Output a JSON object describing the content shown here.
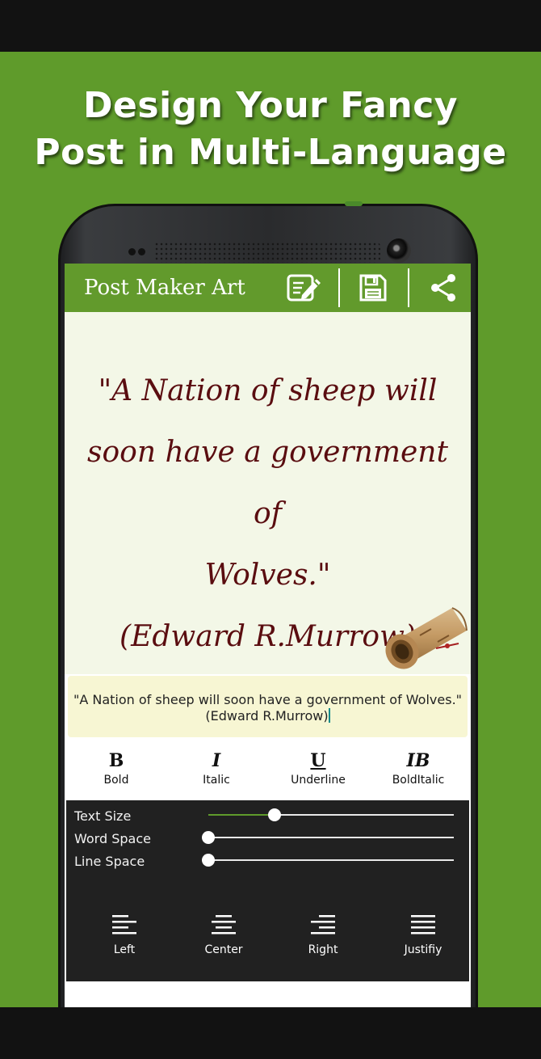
{
  "promo": {
    "headline_line1": "Design Your Fancy",
    "headline_line2": "Post in Multi-Language"
  },
  "appbar": {
    "title": "Post Maker Art",
    "actions": [
      {
        "name": "edit",
        "icon": "edit-note-icon"
      },
      {
        "name": "save",
        "icon": "save-floppy-icon"
      },
      {
        "name": "share",
        "icon": "share-icon"
      }
    ]
  },
  "canvas": {
    "quote_text": "\"A Nation of sheep will\nsoon have a government of\nWolves.\"\n(Edward R.Murrow)",
    "quote_color": "#5a0d10",
    "background_color": "#f3f7e7",
    "decoration": "parchment-scroll-image"
  },
  "editor": {
    "value": "\"A Nation of sheep will soon have a government of Wolves.\"\n(Edward R.Murrow)"
  },
  "styles": [
    {
      "glyph": "B",
      "label": "Bold"
    },
    {
      "glyph": "I",
      "label": "Italic"
    },
    {
      "glyph": "U",
      "label": "Underline"
    },
    {
      "glyph": "IB",
      "label": "BoldItalic"
    }
  ],
  "sliders": [
    {
      "label": "Text Size",
      "value": 0.27
    },
    {
      "label": "Word Space",
      "value": 0.0
    },
    {
      "label": "Line Space",
      "value": 0.0
    }
  ],
  "alignment": [
    {
      "label": "Left",
      "icon": "align-left-icon"
    },
    {
      "label": "Center",
      "icon": "align-center-icon"
    },
    {
      "label": "Right",
      "icon": "align-right-icon"
    },
    {
      "label": "Justifiy",
      "icon": "align-justify-icon"
    }
  ],
  "colors": {
    "brand_green": "#5f9b2b",
    "appbar_green": "#629a2c",
    "panel_dark": "#212121",
    "editor_bg": "#f7f6d3"
  }
}
